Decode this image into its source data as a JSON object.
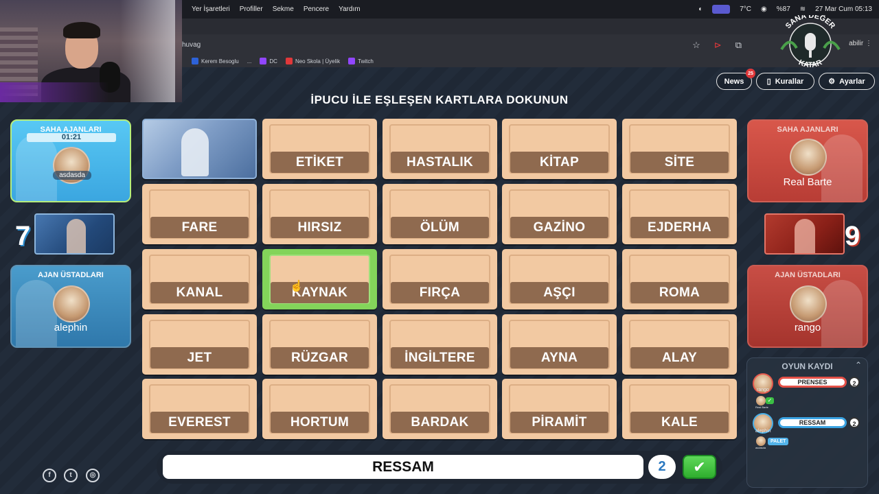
{
  "menubar": {
    "items": [
      "Yer İşaretleri",
      "Profiller",
      "Sekme",
      "Pencere",
      "Yardım"
    ],
    "temperature": "7°C",
    "battery": "%87",
    "datetime": "27 Mar Cum  05:13"
  },
  "browser": {
    "url": "huvag",
    "profile_label": "abilir",
    "bookmarks": [
      {
        "label": "Kerem Besoglu",
        "color": "#2d62d8"
      },
      {
        "label": "...",
        "color": "#2f3138"
      },
      {
        "label": "DC",
        "color": "#9146ff"
      },
      {
        "label": "Neo Skola | Üyelik",
        "color": "#e0383a"
      },
      {
        "label": "Twitch",
        "color": "#9146ff"
      }
    ]
  },
  "logo": {
    "text_top": "SANA DEĞER",
    "text_bottom": "KATAR"
  },
  "nav": {
    "news_label": "News",
    "news_count": "25",
    "rules_label": "Kurallar",
    "settings_label": "Ayarlar"
  },
  "instruction": "İPUCU İLE EŞLEŞEN KARTLARA DOKUNUN",
  "blue_team": {
    "field_title": "SAHA AJANLARI",
    "timer": "01:21",
    "field_player": "asdasda",
    "master_title": "AJAN ÜSTADLARI",
    "master_player": "alephin",
    "score": "7"
  },
  "red_team": {
    "field_title": "SAHA AJANLARI",
    "field_player": "Real Barte",
    "master_title": "AJAN ÜSTADLARI",
    "master_player": "rango",
    "score": "9"
  },
  "cards": [
    {
      "word": "",
      "state": "revealed-blue"
    },
    {
      "word": "ETİKET",
      "state": "hidden"
    },
    {
      "word": "HASTALIK",
      "state": "hidden"
    },
    {
      "word": "KİTAP",
      "state": "hidden"
    },
    {
      "word": "SİTE",
      "state": "hidden"
    },
    {
      "word": "FARE",
      "state": "hidden"
    },
    {
      "word": "HIRSIZ",
      "state": "hidden"
    },
    {
      "word": "ÖLÜM",
      "state": "hidden"
    },
    {
      "word": "GAZİNO",
      "state": "hidden"
    },
    {
      "word": "EJDERHA",
      "state": "hidden"
    },
    {
      "word": "KANAL",
      "state": "hidden"
    },
    {
      "word": "KAYNAK",
      "state": "selected"
    },
    {
      "word": "FIRÇA",
      "state": "hidden"
    },
    {
      "word": "AŞÇI",
      "state": "hidden"
    },
    {
      "word": "ROMA",
      "state": "hidden"
    },
    {
      "word": "JET",
      "state": "hidden"
    },
    {
      "word": "RÜZGAR",
      "state": "hidden"
    },
    {
      "word": "İNGİLTERE",
      "state": "hidden"
    },
    {
      "word": "AYNA",
      "state": "hidden"
    },
    {
      "word": "ALAY",
      "state": "hidden"
    },
    {
      "word": "EVEREST",
      "state": "hidden"
    },
    {
      "word": "HORTUM",
      "state": "hidden"
    },
    {
      "word": "BARDAK",
      "state": "hidden"
    },
    {
      "word": "PİRAMİT",
      "state": "hidden"
    },
    {
      "word": "KALE",
      "state": "hidden"
    }
  ],
  "clue": {
    "word": "RESSAM",
    "count": "2",
    "submit_icon": "check-icon"
  },
  "social": [
    {
      "name": "facebook-icon",
      "glyph": "f"
    },
    {
      "name": "twitter-icon",
      "glyph": "t"
    },
    {
      "name": "instagram-icon",
      "glyph": "◎"
    }
  ],
  "game_log": {
    "title": "OYUN KAYDI",
    "entries": [
      {
        "player": "rango",
        "team": "red",
        "clue": "PRENSES",
        "count": "2",
        "guesser": "Real Barte",
        "guess": ""
      },
      {
        "player": "alephin",
        "team": "blue",
        "clue": "RESSAM",
        "count": "2",
        "guesser": "asdasda",
        "guess": "PALET"
      }
    ]
  },
  "colors": {
    "blue_team": "#3ba6e0",
    "red_team": "#c84e45",
    "card_face": "#f2c9a2",
    "card_label": "#8f6a4f",
    "selected": "#83d45a"
  }
}
